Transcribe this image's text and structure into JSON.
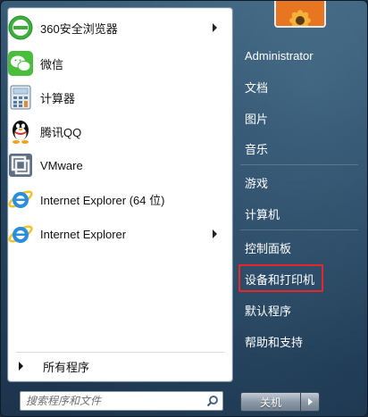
{
  "programs": [
    {
      "label": "360安全浏览器",
      "icon": "360-browser-icon",
      "has_submenu": true
    },
    {
      "label": "微信",
      "icon": "wechat-icon",
      "has_submenu": false
    },
    {
      "label": "计算器",
      "icon": "calculator-icon",
      "has_submenu": false
    },
    {
      "label": "腾讯QQ",
      "icon": "qq-icon",
      "has_submenu": false
    },
    {
      "label": "VMware",
      "icon": "vmware-icon",
      "has_submenu": false
    },
    {
      "label": "Internet Explorer (64 位)",
      "icon": "internet-explorer-icon",
      "has_submenu": false
    },
    {
      "label": "Internet Explorer",
      "icon": "internet-explorer-icon",
      "has_submenu": true
    }
  ],
  "all_programs_label": "所有程序",
  "search": {
    "placeholder": "搜索程序和文件"
  },
  "right_links": {
    "user": "Administrator",
    "documents": "文档",
    "pictures": "图片",
    "music": "音乐",
    "games": "游戏",
    "computer": "计算机",
    "control_panel": "控制面板",
    "devices_printers": "设备和打印机",
    "default_programs": "默认程序",
    "help": "帮助和支持"
  },
  "shutdown_label": "关机",
  "colors": {
    "highlight": "#e5262b",
    "pane_bg": "#ffffff"
  }
}
